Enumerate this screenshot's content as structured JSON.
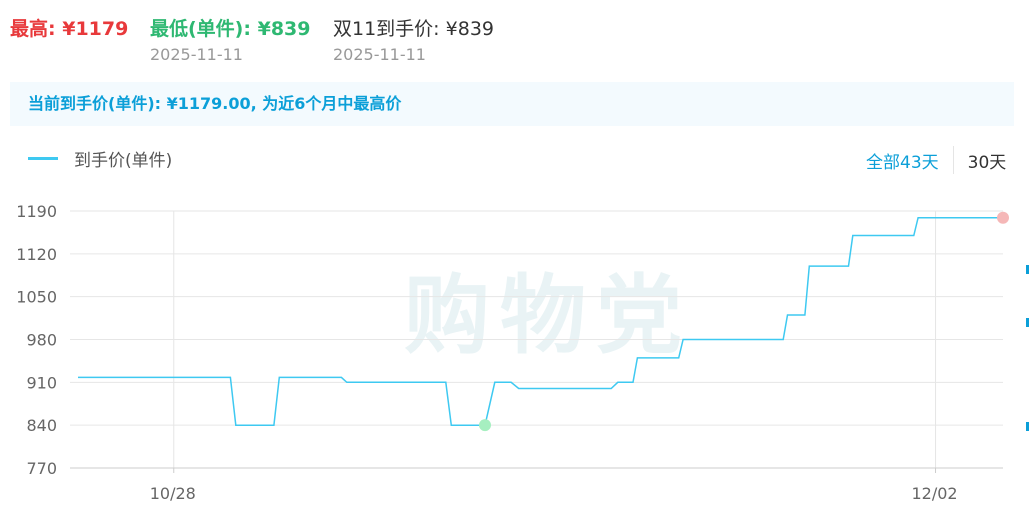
{
  "header": {
    "high": {
      "label": "最高:",
      "price": "¥1179",
      "date": ""
    },
    "low": {
      "label": "最低(单件):",
      "price": "¥839",
      "date": "2025-11-11"
    },
    "double11": {
      "label": "双11到手价:",
      "price": "¥839",
      "date": "2025-11-11"
    }
  },
  "banner": {
    "text": "当前到手价(单件): ¥1179.00, 为近6个月中最高价"
  },
  "legend": {
    "series_name": "到手价(单件)"
  },
  "range_tabs": {
    "all": "全部43天",
    "d30": "30天"
  },
  "watermark": "购物党",
  "colors": {
    "line": "#3ec9f1",
    "high": "#e8393b",
    "low": "#2eb872",
    "accent": "#0b9fd8"
  },
  "chart_data": {
    "type": "line",
    "ylim": [
      770,
      1190
    ],
    "y_ticks": [
      1190,
      1120,
      1050,
      980,
      910,
      840,
      770
    ],
    "x_tick_labels": [
      {
        "label": "10/28",
        "day": 8
      },
      {
        "label": "12/02",
        "day": 43
      }
    ],
    "x_range": [
      3.6,
      46.1
    ],
    "grid": true,
    "series": [
      {
        "name": "到手价(单件)",
        "points": [
          [
            3.6,
            918
          ],
          [
            10.6,
            918
          ],
          [
            10.85,
            840
          ],
          [
            12.6,
            840
          ],
          [
            12.85,
            918
          ],
          [
            15.7,
            918
          ],
          [
            15.95,
            910
          ],
          [
            20.5,
            910
          ],
          [
            20.75,
            840
          ],
          [
            22.3,
            840
          ],
          [
            22.75,
            910
          ],
          [
            23.5,
            910
          ],
          [
            23.85,
            900
          ],
          [
            28.1,
            900
          ],
          [
            28.4,
            910
          ],
          [
            29.1,
            910
          ],
          [
            29.3,
            950
          ],
          [
            31.2,
            950
          ],
          [
            31.4,
            980
          ],
          [
            36.0,
            980
          ],
          [
            36.2,
            1020
          ],
          [
            37.0,
            1020
          ],
          [
            37.2,
            1100
          ],
          [
            39.0,
            1100
          ],
          [
            39.2,
            1150
          ],
          [
            42.0,
            1150
          ],
          [
            42.2,
            1179
          ],
          [
            46.1,
            1179
          ]
        ]
      }
    ],
    "markers": [
      {
        "type": "min",
        "x": 22.3,
        "y": 840
      },
      {
        "type": "max",
        "x": 46.1,
        "y": 1179
      }
    ]
  }
}
